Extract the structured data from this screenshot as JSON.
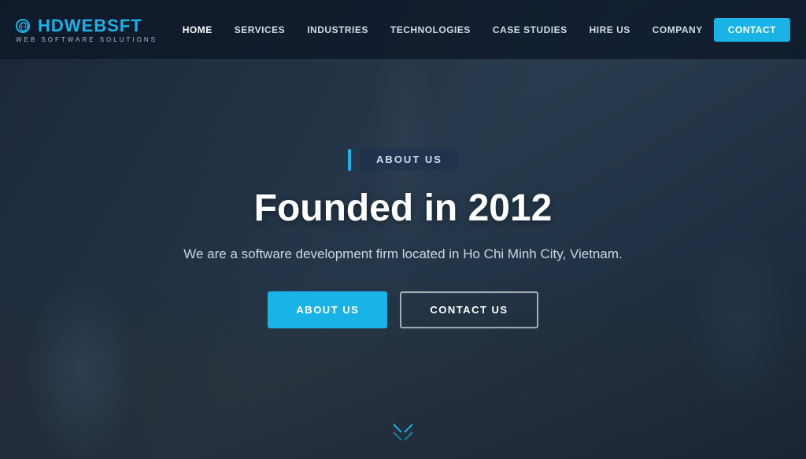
{
  "logo": {
    "name_part1": "HDWEB",
    "name_part2": "S",
    "name_part3": "FT",
    "tagline": "WEB SOFTWARE SOLUTIONS"
  },
  "navbar": {
    "links": [
      {
        "id": "home",
        "label": "HOME",
        "active": true
      },
      {
        "id": "services",
        "label": "SERVICES",
        "active": false
      },
      {
        "id": "industries",
        "label": "INDUSTRIES",
        "active": false
      },
      {
        "id": "technologies",
        "label": "TECHNOLOGIES",
        "active": false
      },
      {
        "id": "case-studies",
        "label": "CASE STUDIES",
        "active": false
      },
      {
        "id": "hire-us",
        "label": "HIRE US",
        "active": false
      },
      {
        "id": "company",
        "label": "COMPANY",
        "active": false
      }
    ],
    "contact_button": "CONTACT"
  },
  "hero": {
    "badge": "ABOUT US",
    "title": "Founded in 2012",
    "subtitle": "We are a software development firm located in Ho Chi Minh City, Vietnam.",
    "btn_about": "ABOUT US",
    "btn_contact": "CONTACT US"
  }
}
